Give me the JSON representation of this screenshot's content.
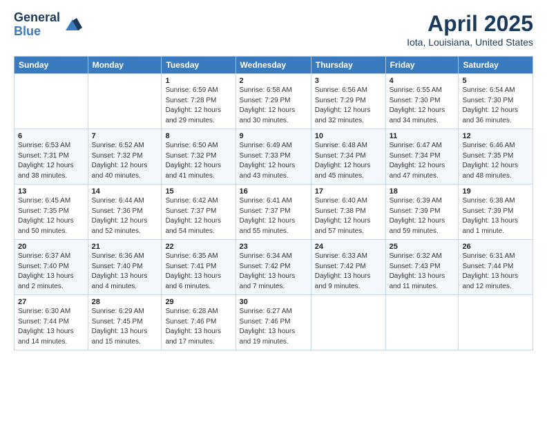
{
  "header": {
    "logo_line1": "General",
    "logo_line2": "Blue",
    "month": "April 2025",
    "location": "Iota, Louisiana, United States"
  },
  "days_of_week": [
    "Sunday",
    "Monday",
    "Tuesday",
    "Wednesday",
    "Thursday",
    "Friday",
    "Saturday"
  ],
  "weeks": [
    [
      {
        "day": "",
        "info": ""
      },
      {
        "day": "",
        "info": ""
      },
      {
        "day": "1",
        "info": "Sunrise: 6:59 AM\nSunset: 7:28 PM\nDaylight: 12 hours and 29 minutes."
      },
      {
        "day": "2",
        "info": "Sunrise: 6:58 AM\nSunset: 7:29 PM\nDaylight: 12 hours and 30 minutes."
      },
      {
        "day": "3",
        "info": "Sunrise: 6:56 AM\nSunset: 7:29 PM\nDaylight: 12 hours and 32 minutes."
      },
      {
        "day": "4",
        "info": "Sunrise: 6:55 AM\nSunset: 7:30 PM\nDaylight: 12 hours and 34 minutes."
      },
      {
        "day": "5",
        "info": "Sunrise: 6:54 AM\nSunset: 7:30 PM\nDaylight: 12 hours and 36 minutes."
      }
    ],
    [
      {
        "day": "6",
        "info": "Sunrise: 6:53 AM\nSunset: 7:31 PM\nDaylight: 12 hours and 38 minutes."
      },
      {
        "day": "7",
        "info": "Sunrise: 6:52 AM\nSunset: 7:32 PM\nDaylight: 12 hours and 40 minutes."
      },
      {
        "day": "8",
        "info": "Sunrise: 6:50 AM\nSunset: 7:32 PM\nDaylight: 12 hours and 41 minutes."
      },
      {
        "day": "9",
        "info": "Sunrise: 6:49 AM\nSunset: 7:33 PM\nDaylight: 12 hours and 43 minutes."
      },
      {
        "day": "10",
        "info": "Sunrise: 6:48 AM\nSunset: 7:34 PM\nDaylight: 12 hours and 45 minutes."
      },
      {
        "day": "11",
        "info": "Sunrise: 6:47 AM\nSunset: 7:34 PM\nDaylight: 12 hours and 47 minutes."
      },
      {
        "day": "12",
        "info": "Sunrise: 6:46 AM\nSunset: 7:35 PM\nDaylight: 12 hours and 48 minutes."
      }
    ],
    [
      {
        "day": "13",
        "info": "Sunrise: 6:45 AM\nSunset: 7:35 PM\nDaylight: 12 hours and 50 minutes."
      },
      {
        "day": "14",
        "info": "Sunrise: 6:44 AM\nSunset: 7:36 PM\nDaylight: 12 hours and 52 minutes."
      },
      {
        "day": "15",
        "info": "Sunrise: 6:42 AM\nSunset: 7:37 PM\nDaylight: 12 hours and 54 minutes."
      },
      {
        "day": "16",
        "info": "Sunrise: 6:41 AM\nSunset: 7:37 PM\nDaylight: 12 hours and 55 minutes."
      },
      {
        "day": "17",
        "info": "Sunrise: 6:40 AM\nSunset: 7:38 PM\nDaylight: 12 hours and 57 minutes."
      },
      {
        "day": "18",
        "info": "Sunrise: 6:39 AM\nSunset: 7:39 PM\nDaylight: 12 hours and 59 minutes."
      },
      {
        "day": "19",
        "info": "Sunrise: 6:38 AM\nSunset: 7:39 PM\nDaylight: 13 hours and 1 minute."
      }
    ],
    [
      {
        "day": "20",
        "info": "Sunrise: 6:37 AM\nSunset: 7:40 PM\nDaylight: 13 hours and 2 minutes."
      },
      {
        "day": "21",
        "info": "Sunrise: 6:36 AM\nSunset: 7:40 PM\nDaylight: 13 hours and 4 minutes."
      },
      {
        "day": "22",
        "info": "Sunrise: 6:35 AM\nSunset: 7:41 PM\nDaylight: 13 hours and 6 minutes."
      },
      {
        "day": "23",
        "info": "Sunrise: 6:34 AM\nSunset: 7:42 PM\nDaylight: 13 hours and 7 minutes."
      },
      {
        "day": "24",
        "info": "Sunrise: 6:33 AM\nSunset: 7:42 PM\nDaylight: 13 hours and 9 minutes."
      },
      {
        "day": "25",
        "info": "Sunrise: 6:32 AM\nSunset: 7:43 PM\nDaylight: 13 hours and 11 minutes."
      },
      {
        "day": "26",
        "info": "Sunrise: 6:31 AM\nSunset: 7:44 PM\nDaylight: 13 hours and 12 minutes."
      }
    ],
    [
      {
        "day": "27",
        "info": "Sunrise: 6:30 AM\nSunset: 7:44 PM\nDaylight: 13 hours and 14 minutes."
      },
      {
        "day": "28",
        "info": "Sunrise: 6:29 AM\nSunset: 7:45 PM\nDaylight: 13 hours and 15 minutes."
      },
      {
        "day": "29",
        "info": "Sunrise: 6:28 AM\nSunset: 7:46 PM\nDaylight: 13 hours and 17 minutes."
      },
      {
        "day": "30",
        "info": "Sunrise: 6:27 AM\nSunset: 7:46 PM\nDaylight: 13 hours and 19 minutes."
      },
      {
        "day": "",
        "info": ""
      },
      {
        "day": "",
        "info": ""
      },
      {
        "day": "",
        "info": ""
      }
    ]
  ]
}
